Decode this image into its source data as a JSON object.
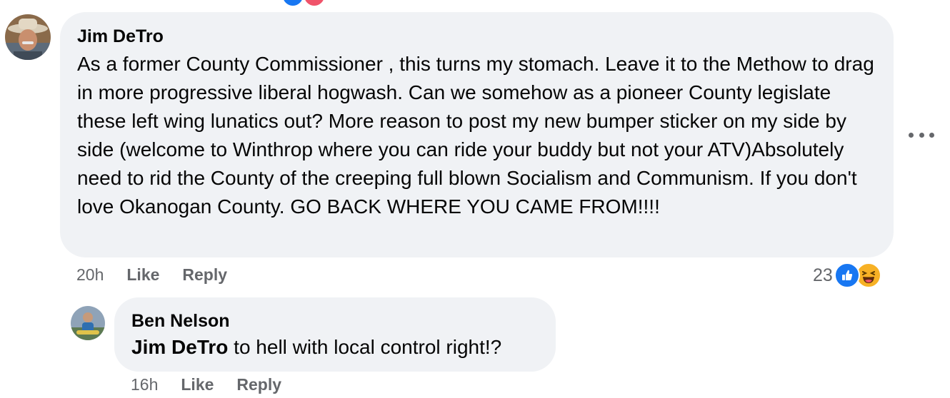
{
  "comments": [
    {
      "author": "Jim DeTro",
      "text": "As a former County Commissioner , this turns my stomach. Leave it to the Methow to drag in more progressive liberal hogwash. Can we somehow as a pioneer County legislate these left wing lunatics out? More reason to post my new bumper sticker on my side by side (welcome to Winthrop where you can ride your buddy but not your ATV)Absolutely need to rid the County of the creeping full blown Socialism and Communism. If you don't love Okanogan County. GO BACK WHERE YOU CAME FROM!!!!",
      "time": "20h",
      "like_label": "Like",
      "reply_label": "Reply",
      "reaction_count": "23",
      "reactions": [
        "like-icon",
        "haha-icon"
      ]
    },
    {
      "author": "Ben Nelson",
      "mention": "Jim DeTro",
      "text": " to hell with local control right!?",
      "time": "16h",
      "like_label": "Like",
      "reply_label": "Reply"
    }
  ],
  "colors": {
    "bubble": "#f0f2f5",
    "meta_text": "#65676b",
    "like_blue": "#1877f2",
    "haha_yellow": "#f7b125"
  }
}
